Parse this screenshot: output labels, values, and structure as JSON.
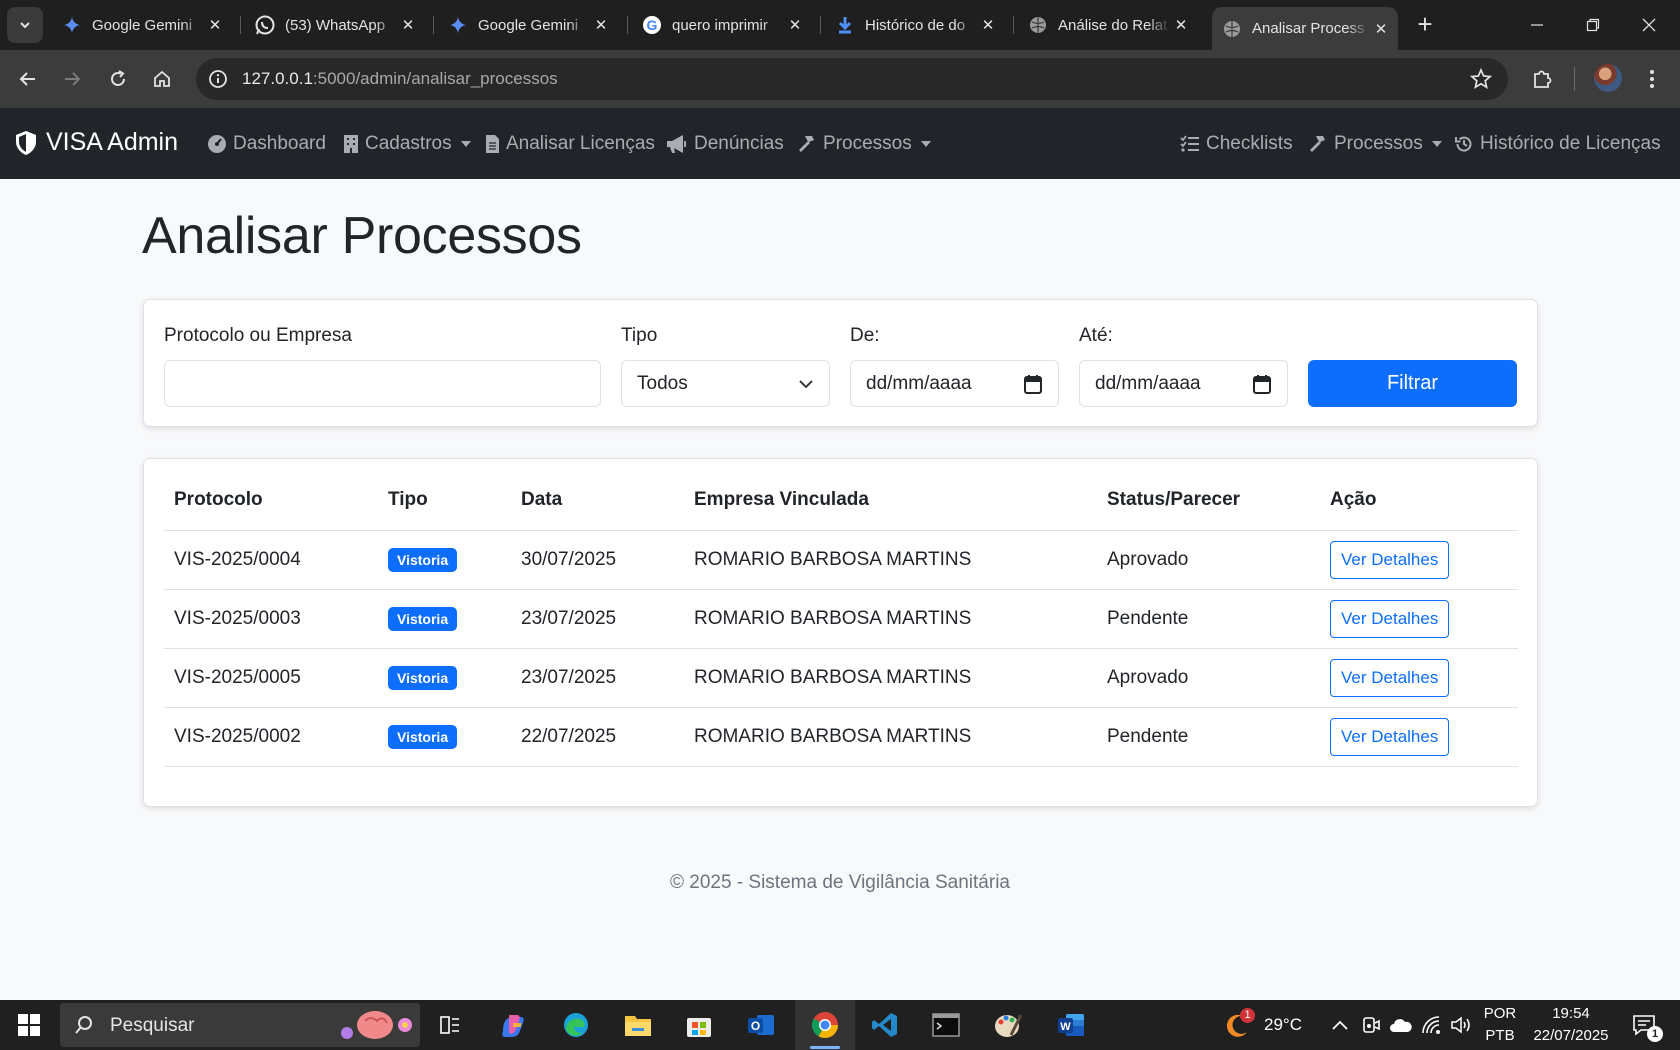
{
  "browser": {
    "tabs": [
      {
        "title": "Google Gemini",
        "icon": "gemini-icon"
      },
      {
        "title": "(53) WhatsApp",
        "icon": "whatsapp-icon"
      },
      {
        "title": "Google Gemini",
        "icon": "gemini-icon"
      },
      {
        "title": "quero imprimir",
        "icon": "google-icon"
      },
      {
        "title": "Histórico de do",
        "icon": "download-icon"
      },
      {
        "title": "Análise do Relat",
        "icon": "globe-icon"
      },
      {
        "title": "Analisar Process",
        "icon": "globe-icon",
        "active": true
      }
    ],
    "url_host": "127.0.0.1",
    "url_path": ":5000/admin/analisar_processos"
  },
  "navbar": {
    "brand": "VISA Admin",
    "left_items": [
      {
        "label": "Dashboard",
        "icon": "dashboard-icon"
      },
      {
        "label": "Cadastros",
        "icon": "building-icon",
        "dropdown": true
      },
      {
        "label": "Analisar Licenças",
        "icon": "file-icon"
      },
      {
        "label": "Denúncias",
        "icon": "megaphone-icon"
      },
      {
        "label": "Processos",
        "icon": "hammer-icon",
        "dropdown": true
      }
    ],
    "right_items": [
      {
        "label": "Checklists",
        "icon": "list-check-icon"
      },
      {
        "label": "Processos",
        "icon": "hammer-icon",
        "dropdown": true
      },
      {
        "label": "Histórico de Licenças",
        "icon": "history-icon"
      }
    ]
  },
  "page": {
    "title": "Analisar Processos"
  },
  "filters": {
    "protocolo_label": "Protocolo ou Empresa",
    "protocolo_value": "",
    "tipo_label": "Tipo",
    "tipo_selected": "Todos",
    "de_label": "De:",
    "de_placeholder": "dd/mm/aaaa",
    "ate_label": "Até:",
    "ate_placeholder": "dd/mm/aaaa",
    "submit_label": "Filtrar"
  },
  "table": {
    "headers": [
      "Protocolo",
      "Tipo",
      "Data",
      "Empresa Vinculada",
      "Status/Parecer",
      "Ação"
    ],
    "rows": [
      {
        "protocolo": "VIS-2025/0004",
        "tipo": "Vistoria",
        "data": "30/07/2025",
        "empresa": "ROMARIO BARBOSA MARTINS",
        "status": "Aprovado",
        "acao": "Ver Detalhes"
      },
      {
        "protocolo": "VIS-2025/0003",
        "tipo": "Vistoria",
        "data": "23/07/2025",
        "empresa": "ROMARIO BARBOSA MARTINS",
        "status": "Pendente",
        "acao": "Ver Detalhes"
      },
      {
        "protocolo": "VIS-2025/0005",
        "tipo": "Vistoria",
        "data": "23/07/2025",
        "empresa": "ROMARIO BARBOSA MARTINS",
        "status": "Aprovado",
        "acao": "Ver Detalhes"
      },
      {
        "protocolo": "VIS-2025/0002",
        "tipo": "Vistoria",
        "data": "22/07/2025",
        "empresa": "ROMARIO BARBOSA MARTINS",
        "status": "Pendente",
        "acao": "Ver Detalhes"
      }
    ]
  },
  "footer": {
    "text": "© 2025 - Sistema de Vigilância Sanitária"
  },
  "taskbar": {
    "search_placeholder": "Pesquisar",
    "weather_temp": "29°C",
    "weather_badge": "1",
    "lang_top": "POR",
    "lang_bottom": "PTB",
    "time": "19:54",
    "date": "22/07/2025",
    "notification_count": "1"
  },
  "colors": {
    "primary": "#0d6efd",
    "navbar_bg": "#212529",
    "page_bg": "#f8f9fa"
  }
}
